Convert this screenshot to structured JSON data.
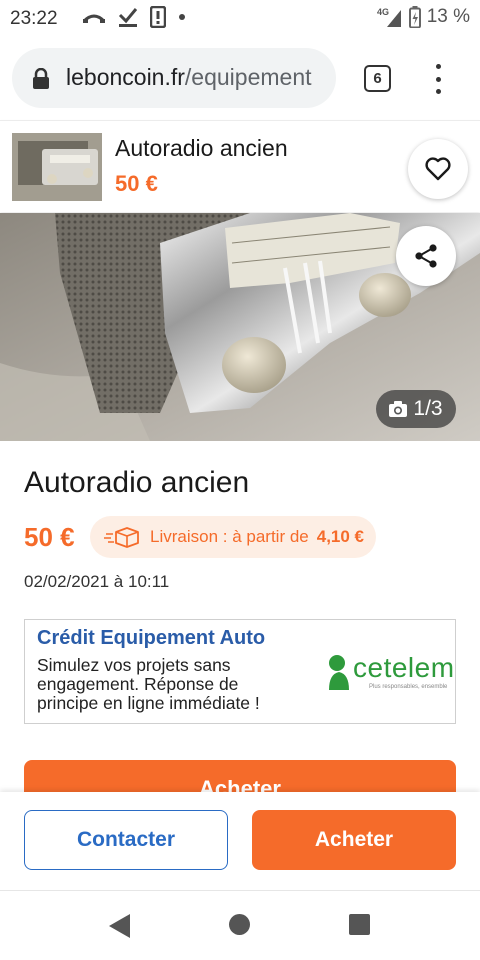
{
  "status_bar": {
    "time": "23:22",
    "network": "4G",
    "battery": "13 %"
  },
  "browser": {
    "url_host": "leboncoin.fr",
    "url_path": "/equipement",
    "tab_count": "6"
  },
  "sticky_header": {
    "title": "Autoradio ancien",
    "price": "50 €"
  },
  "gallery": {
    "counter": "1/3"
  },
  "ad": {
    "title": "Autoradio ancien",
    "price": "50 €",
    "delivery_prefix": "Livraison : à partir de",
    "delivery_price": "4,10 €",
    "date": "02/02/2021 à 10:11"
  },
  "credit": {
    "title": "Crédit Equipement Auto",
    "text": "Simulez vos projets sans engagement. Réponse de principe en ligne immédiate !",
    "brand": "cetelem",
    "tagline": "Plus responsables, ensemble"
  },
  "inline_buy_label": "Acheter",
  "actions": {
    "contact_label": "Contacter",
    "buy_label": "Acheter"
  },
  "colors": {
    "accent": "#f56b2a",
    "link_blue": "#2a6bc4",
    "credit_blue": "#2a5ca8",
    "cetelem_green": "#2e9a3c"
  }
}
